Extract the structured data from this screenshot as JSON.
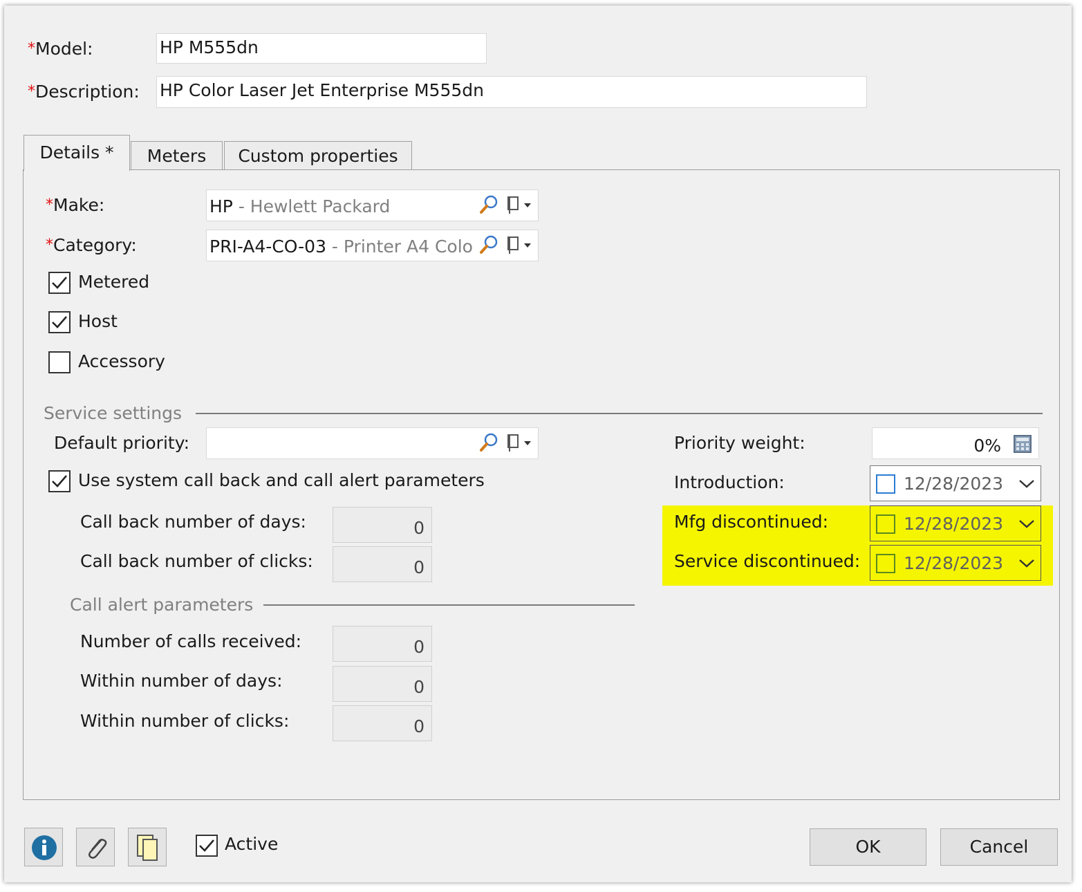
{
  "header": {
    "required_marker": "*",
    "model_label": "Model:",
    "model_value": "HP M555dn",
    "description_label": "Description:",
    "description_value": "HP Color Laser Jet Enterprise M555dn"
  },
  "tabs": [
    {
      "label": "Details *",
      "active": true
    },
    {
      "label": "Meters",
      "active": false
    },
    {
      "label": "Custom properties",
      "active": false
    }
  ],
  "details": {
    "make_label": "Make:",
    "make_code": "HP",
    "make_name": " - Hewlett Packard",
    "category_label": "Category:",
    "category_code": "PRI-A4-CO-03",
    "category_name": " - Printer A4 Colo",
    "metered_label": "Metered",
    "metered_checked": true,
    "host_label": "Host",
    "host_checked": true,
    "accessory_label": "Accessory",
    "accessory_checked": false
  },
  "service": {
    "section_label": "Service settings",
    "default_priority_label": "Default priority:",
    "default_priority_value": "",
    "use_system_label": "Use system call back and call alert parameters",
    "use_system_checked": true,
    "call_back_days_label": "Call back number of days:",
    "call_back_days_value": "0",
    "call_back_clicks_label": "Call back number of clicks:",
    "call_back_clicks_value": "0",
    "call_alert_label": "Call alert parameters",
    "calls_received_label": "Number of calls received:",
    "calls_received_value": "0",
    "within_days_label": "Within number of days:",
    "within_days_value": "0",
    "within_clicks_label": "Within number of clicks:",
    "within_clicks_value": "0",
    "priority_weight_label": "Priority weight:",
    "priority_weight_value": "0%",
    "introduction_label": "Introduction:",
    "introduction_date": "12/28/2023",
    "mfg_discontinued_label": "Mfg discontinued:",
    "mfg_discontinued_date": "12/28/2023",
    "service_discontinued_label": "Service discontinued:",
    "service_discontinued_date": "12/28/2023"
  },
  "footer": {
    "active_label": "Active",
    "active_checked": true,
    "ok_label": "OK",
    "cancel_label": "Cancel"
  },
  "colors": {
    "highlight": "#f5f500",
    "required": "#e01010",
    "info_button": "#1f6fa3"
  }
}
